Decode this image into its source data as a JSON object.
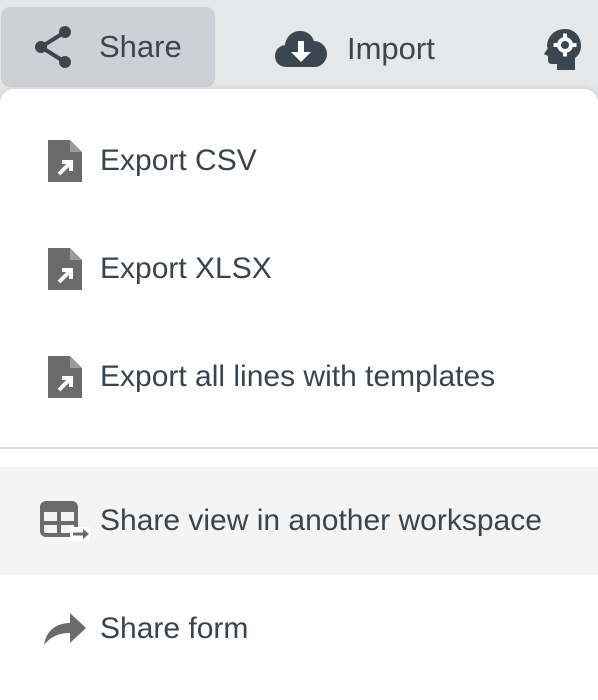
{
  "toolbar": {
    "share_label": "Share",
    "import_label": "Import",
    "share_icon": "share-icon",
    "import_icon": "cloud-download-icon",
    "settings_icon": "settings-head-icon"
  },
  "menu": {
    "items": [
      {
        "label": "Export CSV",
        "icon": "file-export-icon"
      },
      {
        "label": "Export XLSX",
        "icon": "file-export-icon"
      },
      {
        "label": "Export all lines with templates",
        "icon": "file-export-icon"
      },
      {
        "label": "Share view in another workspace",
        "icon": "view-share-icon"
      },
      {
        "label": "Share form",
        "icon": "share-arrow-icon"
      }
    ]
  },
  "colors": {
    "text": "#3a444e",
    "icon": "#6b6b6b",
    "toolbar_bg": "#e6e7e9",
    "active_button_bg": "#cdd1d5",
    "menu_highlight": "#f4f4f4"
  }
}
